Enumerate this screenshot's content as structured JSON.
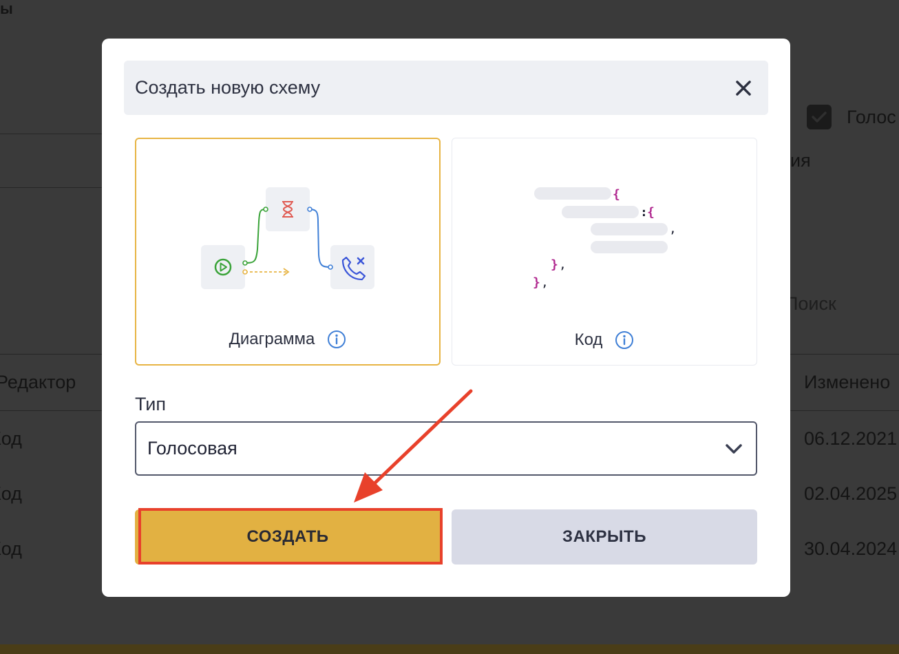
{
  "background": {
    "texts": {
      "top_left": "ы",
      "golos_partial": "Голос",
      "ya_partial": "ия",
      "search": "Поиск",
      "editor_col": "Редактор",
      "changed_col": "Изменено",
      "row1_editor": "Код",
      "row2_editor": "Код",
      "row3_editor": "Код",
      "row1_date": "06.12.2021",
      "row2_date": "02.04.2025",
      "row3_date": "30.04.2024"
    }
  },
  "modal": {
    "title": "Создать новую схему",
    "close_icon": "close-icon",
    "options": [
      {
        "label": "Диаграмма",
        "icon": "info-icon",
        "selected": true
      },
      {
        "label": "Код",
        "icon": "info-icon",
        "selected": false
      }
    ],
    "type_label": "Тип",
    "type_value": "Голосовая",
    "create_label": "СОЗДАТЬ",
    "close_label": "ЗАКРЫТЬ"
  },
  "colors": {
    "accent": "#e2b142",
    "annotation": "#e8412b",
    "info": "#3f7fd6"
  }
}
